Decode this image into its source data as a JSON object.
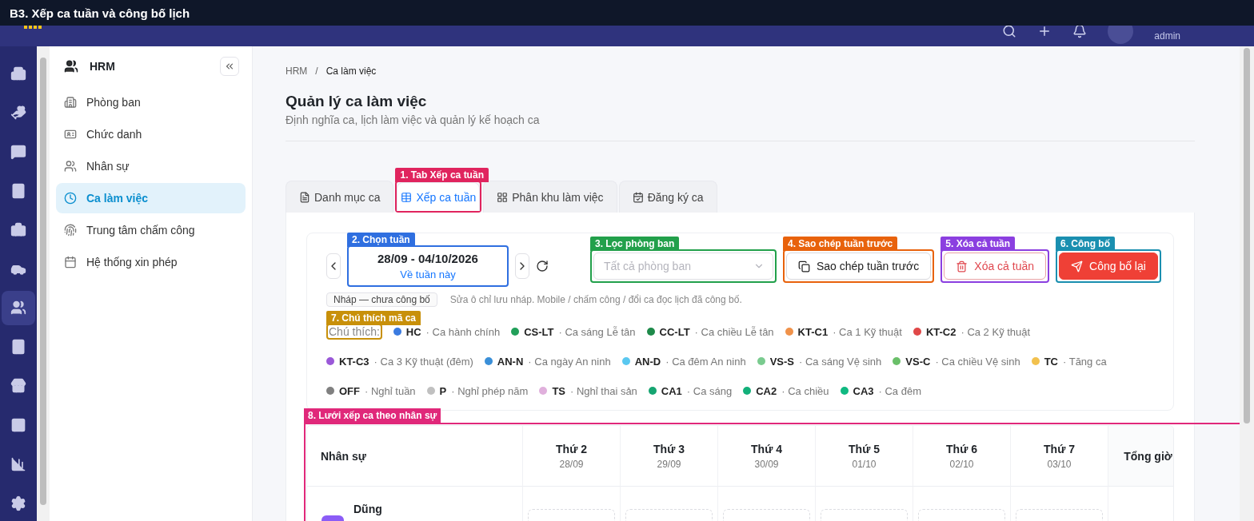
{
  "window": {
    "title": "B3. Xếp ca tuần và công bố lịch"
  },
  "header": {
    "user_role": "admin"
  },
  "rail": [
    {
      "selected": false
    },
    {
      "selected": false
    },
    {
      "selected": false
    },
    {
      "selected": false
    },
    {
      "selected": false
    },
    {
      "selected": false
    },
    {
      "selected": true
    },
    {
      "selected": false
    },
    {
      "selected": false
    },
    {
      "selected": false
    },
    {
      "selected": false
    },
    {
      "selected": false
    }
  ],
  "sidebar": {
    "title": "HRM",
    "items": [
      {
        "label": "Phòng ban",
        "selected": false
      },
      {
        "label": "Chức danh",
        "selected": false
      },
      {
        "label": "Nhân sự",
        "selected": false
      },
      {
        "label": "Ca làm việc",
        "selected": true
      },
      {
        "label": "Trung tâm chấm công",
        "selected": false
      },
      {
        "label": "Hệ thống xin phép",
        "selected": false
      }
    ]
  },
  "breadcrumb": {
    "items": [
      "HRM",
      "Ca làm việc"
    ],
    "separator": "/"
  },
  "page": {
    "title": "Quản lý ca làm việc",
    "subtitle": "Định nghĩa ca, lịch làm việc và quản lý kế hoạch ca"
  },
  "tabs": [
    {
      "label": "Danh mục ca",
      "selected": false
    },
    {
      "label": "Xếp ca tuần",
      "selected": true,
      "annotation": {
        "label": "1. Tab Xếp ca tuần",
        "color": "#e0245e"
      }
    },
    {
      "label": "Phân khu làm việc",
      "selected": false
    },
    {
      "label": "Đăng ký ca",
      "selected": false
    }
  ],
  "week": {
    "range": "28/09 - 04/10/2026",
    "today_link": "Về tuần này",
    "annotation": {
      "label": "2. Chọn tuần",
      "color": "#2f6fe0"
    }
  },
  "department_filter": {
    "placeholder": "Tất cả phòng ban",
    "annotation": {
      "label": "3. Lọc phòng ban",
      "color": "#22a04b"
    }
  },
  "actions": [
    {
      "kind": "copy",
      "label": "Sao chép tuần trước",
      "annotation": {
        "label": "4. Sao chép tuần trước",
        "color": "#e8620c"
      }
    },
    {
      "kind": "clear",
      "label": "Xóa cả tuần",
      "annotation": {
        "label": "5. Xóa cả tuần",
        "color": "#8b3fe0"
      }
    },
    {
      "kind": "publish",
      "label": "Công bố lại",
      "annotation": {
        "label": "6. Công bố",
        "color": "#1a8fb0"
      }
    }
  ],
  "status": {
    "badge": "Nháp — chưa công bố",
    "note": "Sửa ô chỉ lưu nháp. Mobile / chấm công / đổi ca đọc lịch đã công bố."
  },
  "legend": {
    "label": "Chú thích:",
    "annotation": {
      "label": "7. Chú thích mã ca",
      "color": "#c8900a"
    },
    "items": [
      {
        "code": "HC",
        "name": "· Ca hành chính",
        "color": "#3b7be0"
      },
      {
        "code": "CS-LT",
        "name": "· Ca sáng Lễ tân",
        "color": "#22a05a"
      },
      {
        "code": "CC-LT",
        "name": "· Ca chiều Lễ tân",
        "color": "#1e8a4a"
      },
      {
        "code": "KT-C1",
        "name": "· Ca 1 Kỹ thuật",
        "color": "#f0924a"
      },
      {
        "code": "KT-C2",
        "name": "· Ca 2 Kỹ thuật",
        "color": "#e04848"
      },
      {
        "code": "KT-C3",
        "name": "· Ca 3 Kỹ thuật (đêm)",
        "color": "#9a58d8"
      },
      {
        "code": "AN-N",
        "name": "· Ca ngày An ninh",
        "color": "#3a8fd8"
      },
      {
        "code": "AN-D",
        "name": "· Ca đêm An ninh",
        "color": "#5ac8f0"
      },
      {
        "code": "VS-S",
        "name": "· Ca sáng Vệ sinh",
        "color": "#7acb8f"
      },
      {
        "code": "VS-C",
        "name": "· Ca chiều Vệ sinh",
        "color": "#6abf69"
      },
      {
        "code": "TC",
        "name": "· Tăng ca",
        "color": "#f2c14e"
      },
      {
        "code": "OFF",
        "name": "· Nghỉ tuần",
        "color": "#808080"
      },
      {
        "code": "P",
        "name": "· Nghỉ phép năm",
        "color": "#c0c0c0"
      },
      {
        "code": "TS",
        "name": "· Nghỉ thai sản",
        "color": "#e0b0dc"
      },
      {
        "code": "CA1",
        "name": "· Ca sáng",
        "color": "#16a571"
      },
      {
        "code": "CA2",
        "name": "· Ca chiều",
        "color": "#13b07a"
      },
      {
        "code": "CA3",
        "name": "· Ca đêm",
        "color": "#10b981"
      }
    ]
  },
  "grid": {
    "annotation": {
      "label": "8. Lưới xếp ca theo nhân sự",
      "color": "#e0287a"
    },
    "staff_header": "Nhân sự",
    "total_header": "Tổng giờ",
    "columns": [
      {
        "day": "Thứ 2",
        "date": "28/09"
      },
      {
        "day": "Thứ 3",
        "date": "29/09"
      },
      {
        "day": "Thứ 4",
        "date": "30/09"
      },
      {
        "day": "Thứ 5",
        "date": "01/10"
      },
      {
        "day": "Thứ 6",
        "date": "02/10"
      },
      {
        "day": "Thứ 7",
        "date": "03/10"
      }
    ],
    "rows": [
      {
        "name": "Dũng"
      }
    ]
  }
}
